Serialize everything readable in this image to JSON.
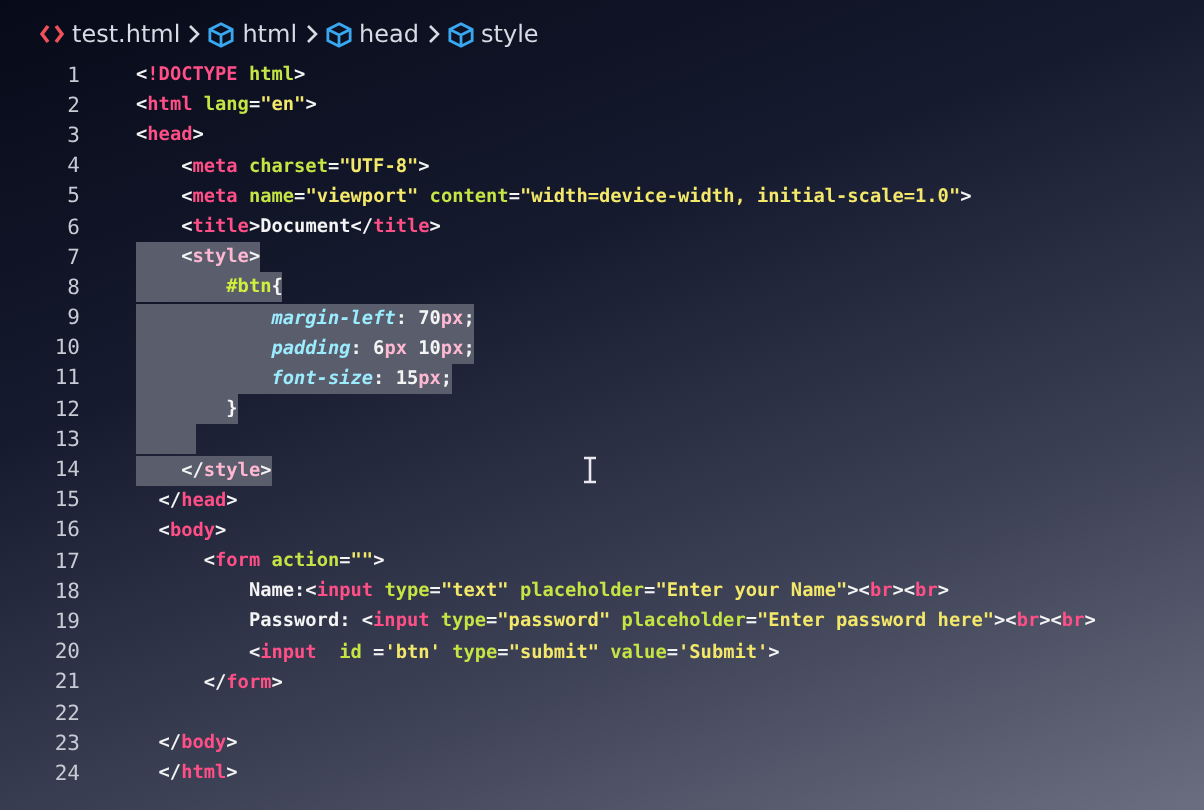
{
  "breadcrumb": [
    {
      "label": "test.html",
      "kind": "file"
    },
    {
      "label": "html",
      "kind": "element"
    },
    {
      "label": "head",
      "kind": "element"
    },
    {
      "label": "style",
      "kind": "element"
    }
  ],
  "lines": [
    {
      "number": "1",
      "selected": false,
      "tokens": [
        {
          "text": "<",
          "kind": "punct"
        },
        {
          "text": "!DOCTYPE",
          "kind": "tag"
        },
        {
          "text": " html",
          "kind": "attr"
        },
        {
          "text": ">",
          "kind": "punct"
        }
      ]
    },
    {
      "number": "2",
      "selected": false,
      "tokens": [
        {
          "text": "<",
          "kind": "punct"
        },
        {
          "text": "html",
          "kind": "tag"
        },
        {
          "text": " lang",
          "kind": "attr"
        },
        {
          "text": "=",
          "kind": "punct"
        },
        {
          "text": "\"en\"",
          "kind": "string"
        },
        {
          "text": ">",
          "kind": "punct"
        }
      ]
    },
    {
      "number": "3",
      "selected": false,
      "tokens": [
        {
          "text": "<",
          "kind": "punct"
        },
        {
          "text": "head",
          "kind": "tag"
        },
        {
          "text": ">",
          "kind": "punct"
        }
      ]
    },
    {
      "number": "4",
      "selected": false,
      "tokens": [
        {
          "text": "    <",
          "kind": "punct"
        },
        {
          "text": "meta",
          "kind": "tag"
        },
        {
          "text": " charset",
          "kind": "attr"
        },
        {
          "text": "=",
          "kind": "punct"
        },
        {
          "text": "\"UTF-8\"",
          "kind": "string"
        },
        {
          "text": ">",
          "kind": "punct"
        }
      ]
    },
    {
      "number": "5",
      "selected": false,
      "tokens": [
        {
          "text": "    <",
          "kind": "punct"
        },
        {
          "text": "meta",
          "kind": "tag"
        },
        {
          "text": " name",
          "kind": "attr"
        },
        {
          "text": "=",
          "kind": "punct"
        },
        {
          "text": "\"viewport\"",
          "kind": "string"
        },
        {
          "text": " content",
          "kind": "attr"
        },
        {
          "text": "=",
          "kind": "punct"
        },
        {
          "text": "\"width=device-width, initial-scale=1.0\"",
          "kind": "string"
        },
        {
          "text": ">",
          "kind": "punct"
        }
      ]
    },
    {
      "number": "6",
      "selected": false,
      "tokens": [
        {
          "text": "    <",
          "kind": "punct"
        },
        {
          "text": "title",
          "kind": "tag"
        },
        {
          "text": ">Document</",
          "kind": "punct"
        },
        {
          "text": "title",
          "kind": "tag"
        },
        {
          "text": ">",
          "kind": "punct"
        }
      ]
    },
    {
      "number": "7",
      "selected": true,
      "tokens": [
        {
          "text": "    <",
          "kind": "punct"
        },
        {
          "text": "style",
          "kind": "tag"
        },
        {
          "text": ">",
          "kind": "punct"
        }
      ]
    },
    {
      "number": "8",
      "selected": true,
      "tokens": [
        {
          "text": "        #btn",
          "kind": "selector"
        },
        {
          "text": "{",
          "kind": "punct"
        }
      ]
    },
    {
      "number": "9",
      "selected": true,
      "tokens": [
        {
          "text": "            margin-left",
          "kind": "property"
        },
        {
          "text": ": 70",
          "kind": "punct"
        },
        {
          "text": "px",
          "kind": "unit"
        },
        {
          "text": ";",
          "kind": "punct"
        }
      ]
    },
    {
      "number": "10",
      "selected": true,
      "tokens": [
        {
          "text": "            padding",
          "kind": "property"
        },
        {
          "text": ": 6",
          "kind": "punct"
        },
        {
          "text": "px",
          "kind": "unit"
        },
        {
          "text": " 10",
          "kind": "punct"
        },
        {
          "text": "px",
          "kind": "unit"
        },
        {
          "text": ";",
          "kind": "punct"
        }
      ]
    },
    {
      "number": "11",
      "selected": true,
      "tokens": [
        {
          "text": "            font-size",
          "kind": "property"
        },
        {
          "text": ": 15",
          "kind": "punct"
        },
        {
          "text": "px",
          "kind": "unit"
        },
        {
          "text": ";",
          "kind": "punct"
        }
      ]
    },
    {
      "number": "12",
      "selected": true,
      "tokens": [
        {
          "text": "        }",
          "kind": "punct"
        }
      ]
    },
    {
      "number": "13",
      "selected": true
    },
    {
      "number": "14",
      "selected": true,
      "tokens": [
        {
          "text": "    </",
          "kind": "punct"
        },
        {
          "text": "style",
          "kind": "tag"
        },
        {
          "text": ">",
          "kind": "punct"
        }
      ]
    },
    {
      "number": "15",
      "selected": false,
      "tokens": [
        {
          "text": "  </",
          "kind": "punct"
        },
        {
          "text": "head",
          "kind": "tag"
        },
        {
          "text": ">",
          "kind": "punct"
        }
      ]
    },
    {
      "number": "16",
      "selected": false,
      "tokens": [
        {
          "text": "  <",
          "kind": "punct"
        },
        {
          "text": "body",
          "kind": "tag"
        },
        {
          "text": ">",
          "kind": "punct"
        }
      ]
    },
    {
      "number": "17",
      "selected": false,
      "tokens": [
        {
          "text": "      <",
          "kind": "punct"
        },
        {
          "text": "form",
          "kind": "tag"
        },
        {
          "text": " action",
          "kind": "attr"
        },
        {
          "text": "=",
          "kind": "punct"
        },
        {
          "text": "\"\"",
          "kind": "string"
        },
        {
          "text": ">",
          "kind": "punct"
        }
      ]
    },
    {
      "number": "18",
      "selected": false,
      "tokens": [
        {
          "text": "          Name:<",
          "kind": "punct"
        },
        {
          "text": "input",
          "kind": "tag"
        },
        {
          "text": " type",
          "kind": "attr"
        },
        {
          "text": "=",
          "kind": "punct"
        },
        {
          "text": "\"text\"",
          "kind": "string"
        },
        {
          "text": " placeholder",
          "kind": "attr"
        },
        {
          "text": "=",
          "kind": "punct"
        },
        {
          "text": "\"Enter your Name\"",
          "kind": "string"
        },
        {
          "text": "><",
          "kind": "punct"
        },
        {
          "text": "br",
          "kind": "tag"
        },
        {
          "text": "><",
          "kind": "punct"
        },
        {
          "text": "br",
          "kind": "tag"
        },
        {
          "text": ">",
          "kind": "punct"
        }
      ]
    },
    {
      "number": "19",
      "selected": false,
      "tokens": [
        {
          "text": "          Password: <",
          "kind": "punct"
        },
        {
          "text": "input",
          "kind": "tag"
        },
        {
          "text": " type",
          "kind": "attr"
        },
        {
          "text": "=",
          "kind": "punct"
        },
        {
          "text": "\"password\"",
          "kind": "string"
        },
        {
          "text": " placeholder",
          "kind": "attr"
        },
        {
          "text": "=",
          "kind": "punct"
        },
        {
          "text": "\"Enter password here\"",
          "kind": "string"
        },
        {
          "text": "><",
          "kind": "punct"
        },
        {
          "text": "br",
          "kind": "tag"
        },
        {
          "text": "><",
          "kind": "punct"
        },
        {
          "text": "br",
          "kind": "tag"
        },
        {
          "text": ">",
          "kind": "punct"
        }
      ]
    },
    {
      "number": "20",
      "selected": false,
      "tokens": [
        {
          "text": "          <",
          "kind": "punct"
        },
        {
          "text": "input",
          "kind": "tag"
        },
        {
          "text": "  id",
          "kind": "attr"
        },
        {
          "text": " =",
          "kind": "punct"
        },
        {
          "text": "'btn'",
          "kind": "string"
        },
        {
          "text": " type",
          "kind": "attr"
        },
        {
          "text": "=",
          "kind": "punct"
        },
        {
          "text": "\"submit\"",
          "kind": "string"
        },
        {
          "text": " value",
          "kind": "attr"
        },
        {
          "text": "=",
          "kind": "punct"
        },
        {
          "text": "'Submit'",
          "kind": "string"
        },
        {
          "text": ">",
          "kind": "punct"
        }
      ]
    },
    {
      "number": "21",
      "selected": false,
      "tokens": [
        {
          "text": "      </",
          "kind": "punct"
        },
        {
          "text": "form",
          "kind": "tag"
        },
        {
          "text": ">",
          "kind": "punct"
        }
      ]
    },
    {
      "number": "22",
      "selected": false
    },
    {
      "number": "23",
      "selected": false,
      "tokens": [
        {
          "text": "  </",
          "kind": "punct"
        },
        {
          "text": "body",
          "kind": "tag"
        },
        {
          "text": ">",
          "kind": "punct"
        }
      ]
    },
    {
      "number": "24",
      "selected": false,
      "tokens": [
        {
          "text": "  </",
          "kind": "punct"
        },
        {
          "text": "html",
          "kind": "tag"
        },
        {
          "text": ">",
          "kind": "punct"
        }
      ]
    }
  ]
}
